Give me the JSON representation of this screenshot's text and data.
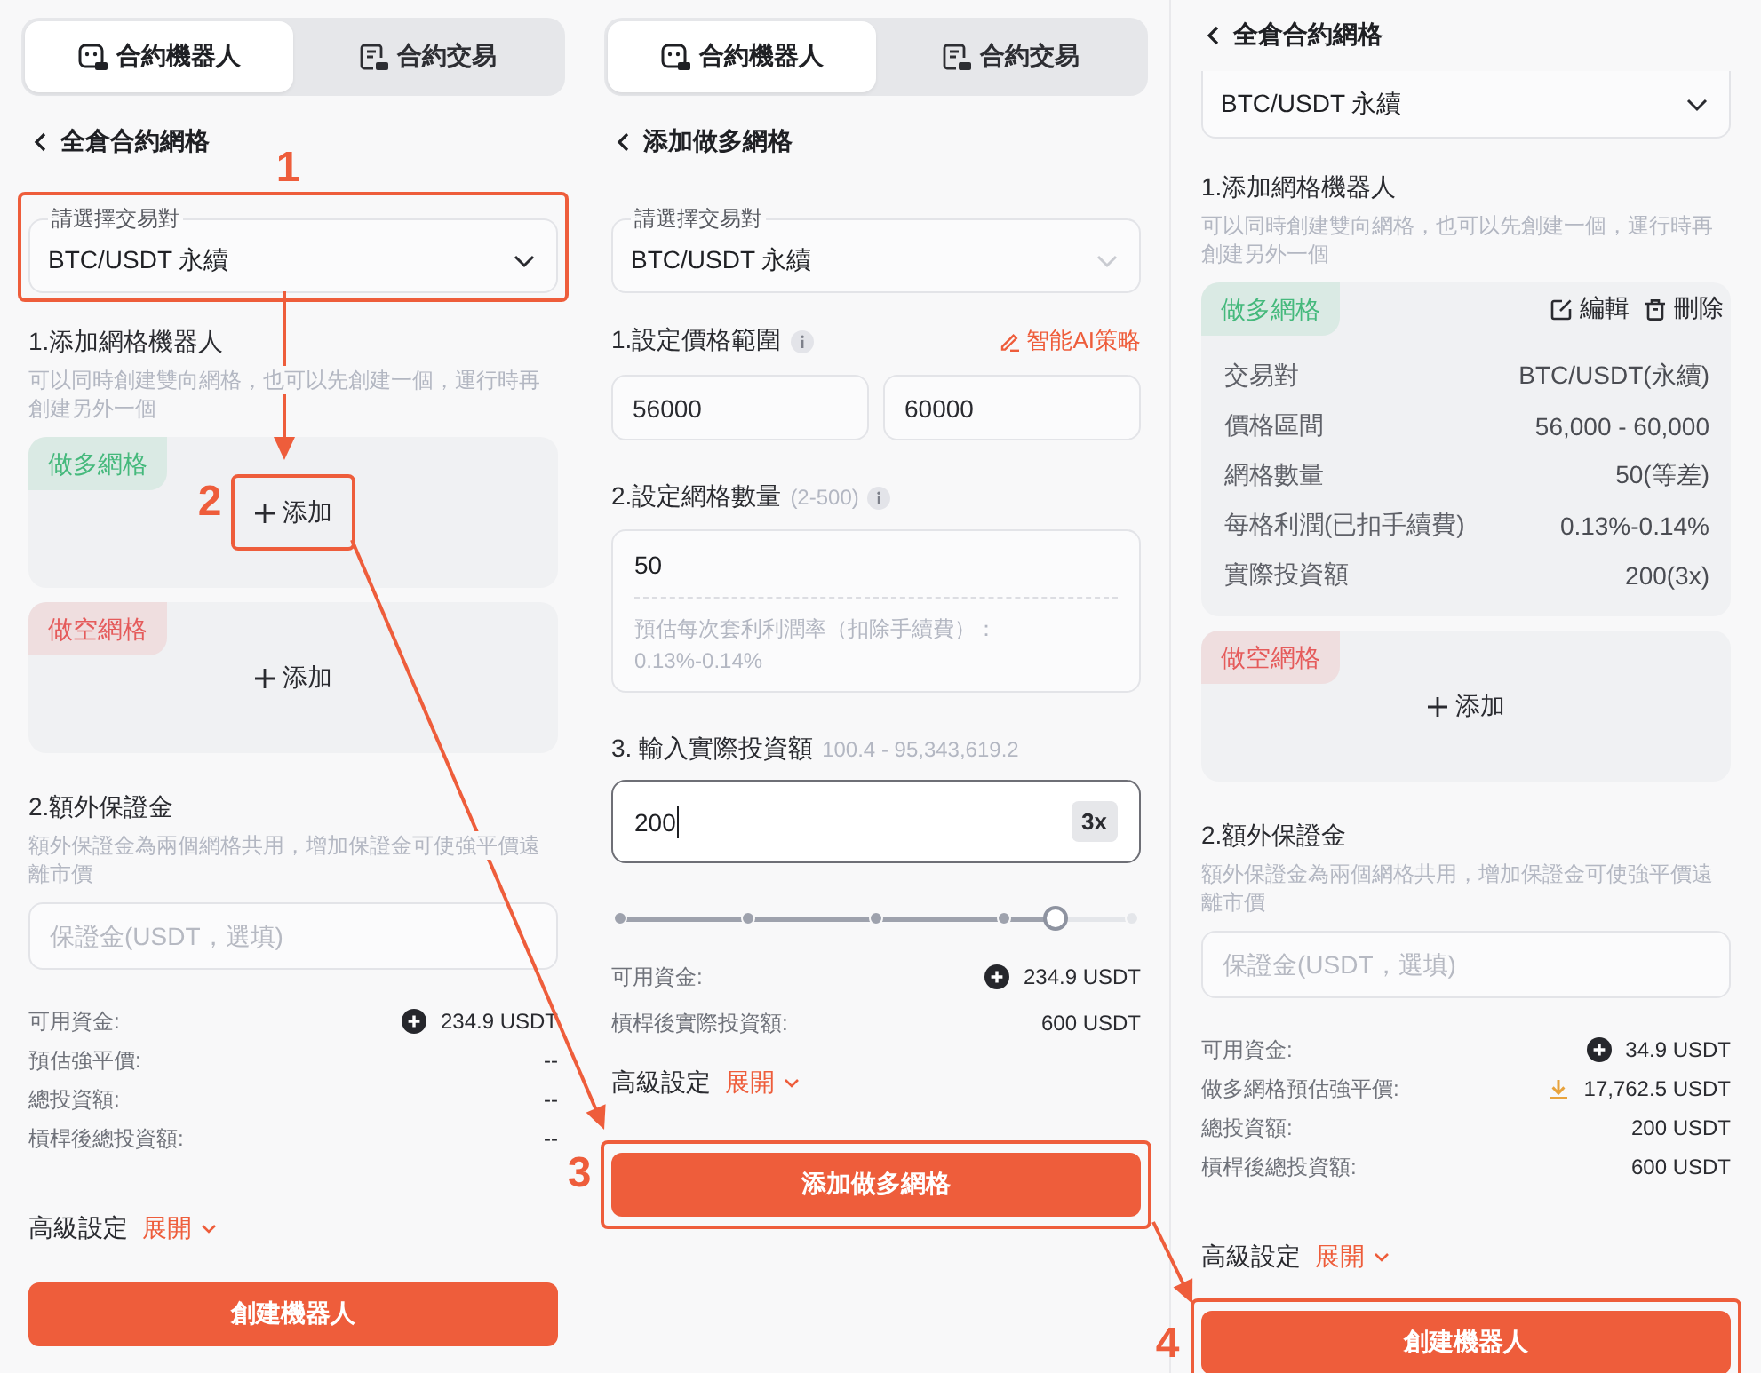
{
  "panels": [
    {
      "tabs": [
        {
          "label": "合約機器人",
          "selected": true
        },
        {
          "label": "合約交易",
          "selected": false
        }
      ],
      "header": "全倉合約網格",
      "blocks": [
        {
          "kind": "pair_select",
          "label": "請選擇交易對",
          "value": "BTC/USDT 永續",
          "disabled": false,
          "highlighted": true
        },
        {
          "kind": "section",
          "title": "1.添加網格機器人",
          "hint": "可以同時創建雙向網格，也可以先創建一個，運行時再創建另外一個"
        },
        {
          "kind": "grid_card",
          "tag": "做多網格",
          "color": "#45b97c",
          "add_label": "添加",
          "highlighted": true
        },
        {
          "kind": "grid_card",
          "tag": "做空網格",
          "color": "#e55b5b",
          "add_label": "添加",
          "highlighted": false
        },
        {
          "kind": "section",
          "title": "2.額外保證金",
          "hint": "額外保證金為兩個網格共用，增加保證金可使強平價遠離市價"
        },
        {
          "kind": "text_input",
          "placeholder": "保證金(USDT，選填)"
        },
        {
          "kind": "summary",
          "rows": [
            {
              "kind": "deposit",
              "label": "可用資金:",
              "value": "234.9 USDT"
            },
            {
              "kind": "plain",
              "label": "預估強平價:",
              "value": "--"
            },
            {
              "kind": "plain",
              "label": "總投資額:",
              "value": "--"
            },
            {
              "kind": "plain",
              "label": "槓桿後總投資額:",
              "value": "--"
            }
          ]
        },
        {
          "kind": "advanced",
          "label": "高級設定",
          "toggle": "展開"
        },
        {
          "kind": "submit",
          "label": "創建機器人",
          "highlighted": false
        }
      ]
    },
    {
      "tabs": [
        {
          "label": "合約機器人",
          "selected": true
        },
        {
          "label": "合約交易",
          "selected": false
        }
      ],
      "header": "添加做多網格",
      "blocks": [
        {
          "kind": "pair_select",
          "label": "請選擇交易對",
          "value": "BTC/USDT 永續",
          "disabled": true,
          "highlighted": false
        },
        {
          "kind": "range_inputs",
          "title": "1.設定價格範圍",
          "link": "智能AI策略",
          "values": [
            "56000",
            "60000"
          ]
        },
        {
          "kind": "grid_count",
          "title": "2.設定網格數量",
          "range": "(2-500)",
          "value": "50",
          "hint": "預估每次套利利潤率（扣除手續費）：",
          "hint_value": "0.13%-0.14%"
        },
        {
          "kind": "investment",
          "title": "3. 輸入實際投資額",
          "range": "100.4 - 95,343,619.2",
          "value": "200",
          "leverage": "3x",
          "level": 0.85,
          "rows": [
            {
              "kind": "deposit",
              "label": "可用資金:",
              "value": "234.9 USDT"
            },
            {
              "kind": "plain",
              "label": "槓桿後實際投資額:",
              "value": "600 USDT"
            }
          ]
        },
        {
          "kind": "advanced",
          "label": "高級設定",
          "toggle": "展開"
        },
        {
          "kind": "submit",
          "label": "添加做多網格",
          "highlighted": true
        }
      ]
    },
    {
      "header": "全倉合約網格",
      "blocks": [
        {
          "kind": "pair_select",
          "value": "BTC/USDT 永續",
          "disabled": false,
          "highlighted": false
        },
        {
          "kind": "section",
          "title": "1.添加網格機器人",
          "hint": "可以同時創建雙向網格，也可以先創建一個，運行時再創建另外一個"
        },
        {
          "kind": "grid_card",
          "tag": "做多網格",
          "color": "#45b97c",
          "actions": [
            {
              "kind": "edit",
              "label": "編輯"
            },
            {
              "kind": "delete",
              "label": "刪除"
            }
          ],
          "details": [
            {
              "label": "交易對",
              "value": "BTC/USDT(永續)"
            },
            {
              "label": "價格區間",
              "value": "56,000 - 60,000"
            },
            {
              "label": "網格數量",
              "value": "50(等差)"
            },
            {
              "label": "每格利潤(已扣手續費)",
              "value": "0.13%-0.14%"
            },
            {
              "label": "實際投資額",
              "value": "200(3x)"
            }
          ]
        },
        {
          "kind": "grid_card",
          "tag": "做空網格",
          "color": "#e55b5b",
          "add_label": "添加",
          "highlighted": false
        },
        {
          "kind": "section",
          "title": "2.額外保證金",
          "hint": "額外保證金為兩個網格共用，增加保證金可使強平價遠離市價"
        },
        {
          "kind": "text_input",
          "placeholder": "保證金(USDT，選填)"
        },
        {
          "kind": "summary",
          "rows": [
            {
              "kind": "deposit",
              "label": "可用資金:",
              "value": "34.9 USDT"
            },
            {
              "kind": "warning",
              "label": "做多網格預估強平價:",
              "value": "17,762.5 USDT"
            },
            {
              "kind": "plain",
              "label": "總投資額:",
              "value": "200 USDT"
            },
            {
              "kind": "plain",
              "label": "槓桿後總投資額:",
              "value": "600 USDT"
            }
          ]
        },
        {
          "kind": "advanced",
          "label": "高級設定",
          "toggle": "展開"
        },
        {
          "kind": "submit",
          "label": "創建機器人",
          "highlighted": true
        }
      ]
    }
  ],
  "annotations": [
    {
      "number": "1"
    },
    {
      "number": "2"
    },
    {
      "number": "3"
    },
    {
      "number": "4"
    }
  ]
}
